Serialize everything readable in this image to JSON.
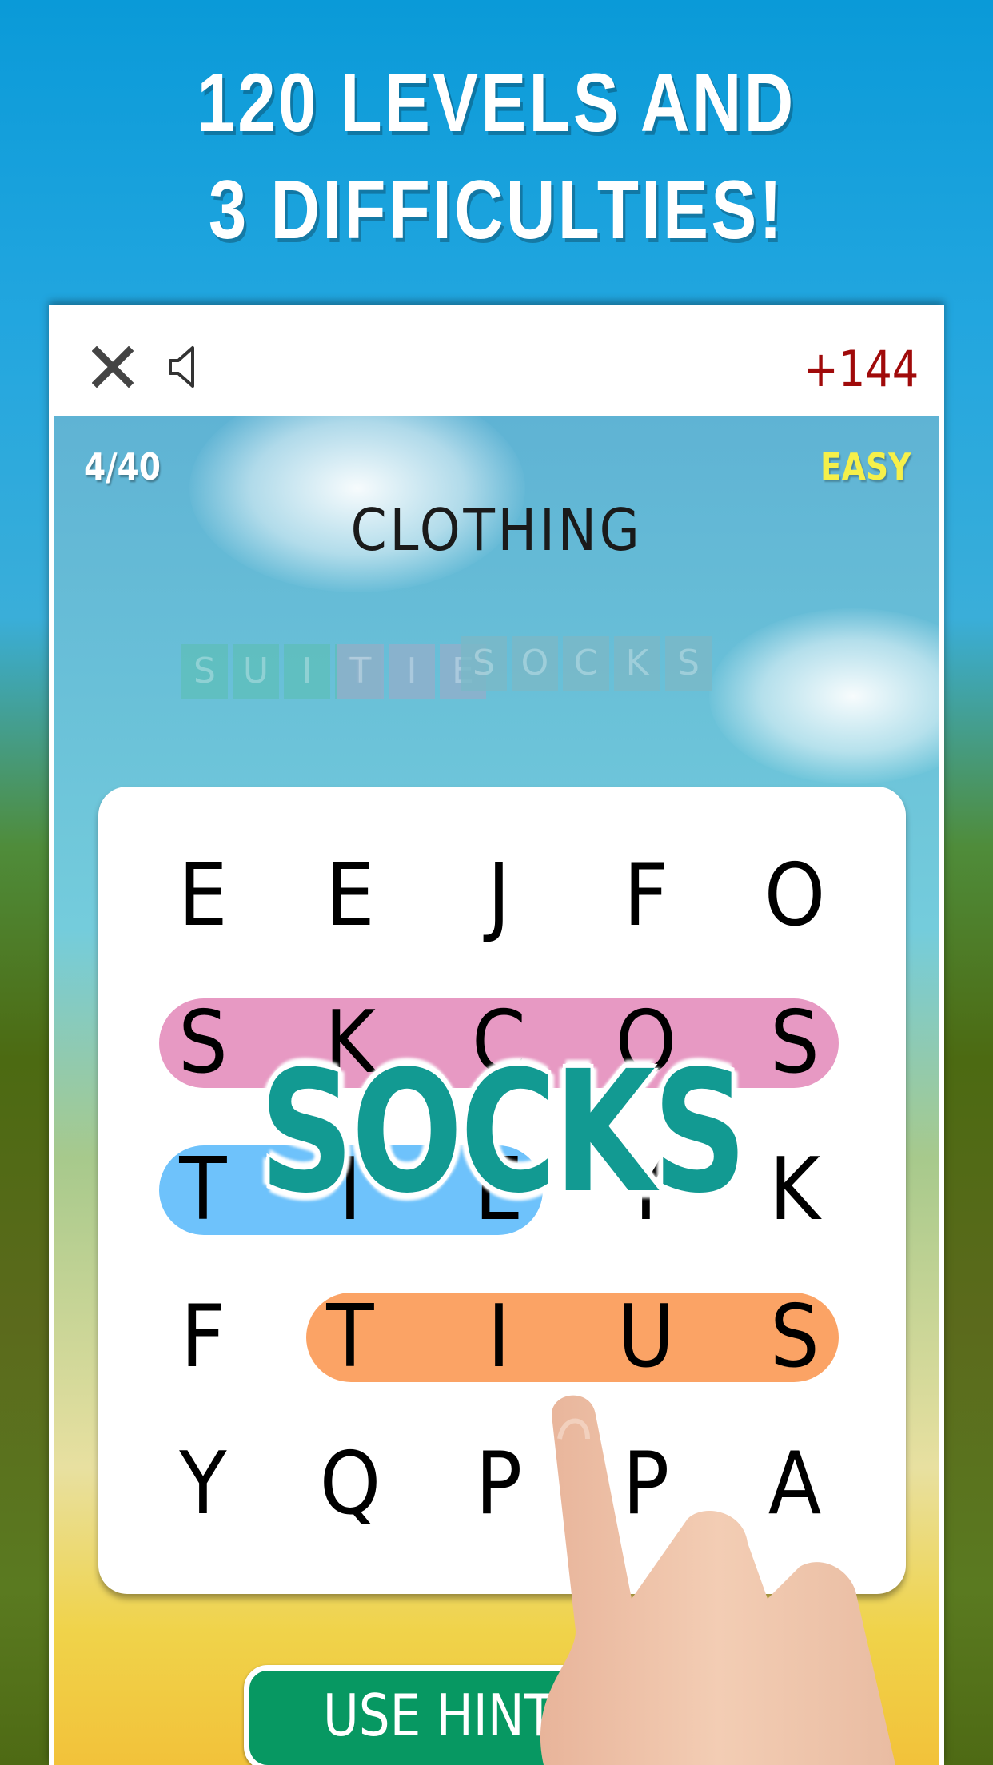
{
  "headline": {
    "line1": "120 LEVELS AND",
    "line2": "3 DIFFICULTIES!"
  },
  "topbar": {
    "close_icon": "close-icon",
    "sound_icon": "speaker-icon",
    "score": "+144"
  },
  "game": {
    "level": "4/40",
    "difficulty": "EASY",
    "category": "CLOTHING",
    "words": [
      {
        "word": "SUIT",
        "letters": [
          "S",
          "U",
          "I",
          "T"
        ],
        "color": "#5fbfbd"
      },
      {
        "word": "TIE",
        "letters": [
          "T",
          "I",
          "E"
        ],
        "color": "#8fb0cc"
      },
      {
        "word": "SOCKS",
        "letters": [
          "S",
          "O",
          "C",
          "K",
          "S"
        ],
        "color": "#7ab9c8"
      }
    ],
    "grid": [
      [
        "E",
        "E",
        "J",
        "F",
        "O"
      ],
      [
        "S",
        "K",
        "C",
        "O",
        "S"
      ],
      [
        "T",
        "I",
        "E",
        "Y",
        "K"
      ],
      [
        "F",
        "T",
        "I",
        "U",
        "S"
      ],
      [
        "Y",
        "Q",
        "P",
        "P",
        "A"
      ]
    ],
    "highlights": [
      {
        "word": "SOCKS",
        "row": 1,
        "from_col": 0,
        "to_col": 4,
        "color": "#e799c3"
      },
      {
        "word": "TIE",
        "row": 2,
        "from_col": 0,
        "to_col": 2,
        "color": "#6ec2fb"
      },
      {
        "word": "SUIT",
        "row": 3,
        "from_col": 1,
        "to_col": 4,
        "color": "#fba365"
      }
    ],
    "found_word_popup": "SOCKS",
    "found_word_color": "#129a92",
    "hint_button": "USE HINT"
  }
}
